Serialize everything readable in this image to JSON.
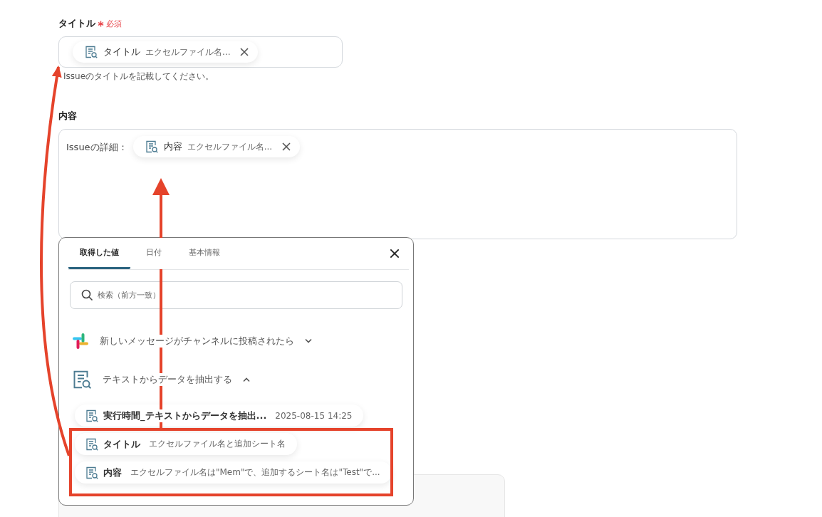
{
  "title_field": {
    "label": "タイトル",
    "required": "必須",
    "chip": {
      "name": "タイトル",
      "value": "エクセルファイル名..."
    },
    "help": "Issueのタイトルを記載してください。"
  },
  "content_field": {
    "label": "内容",
    "prefix": "Issueの詳細：",
    "chip": {
      "name": "内容",
      "value": "エクセルファイル名..."
    }
  },
  "popup": {
    "tabs": [
      {
        "label": "取得した値",
        "selected": true
      },
      {
        "label": "日付",
        "selected": false
      },
      {
        "label": "基本情報",
        "selected": false
      }
    ],
    "search": {
      "placeholder": "検索（前方一致）"
    },
    "sections": [
      {
        "kind": "slack",
        "title": "新しいメッセージがチャンネルに投稿されたら",
        "expanded": false
      },
      {
        "kind": "doc",
        "title": "テキストからデータを抽出する",
        "expanded": true
      }
    ],
    "items": [
      {
        "name": "実行時間_テキストからデータを抽出...",
        "value": "2025-08-15 14:25"
      },
      {
        "name": "タイトル",
        "value": "エクセルファイル名と追加シート名"
      },
      {
        "name": "内容",
        "value": "エクセルファイル名は\"Mem\"で、追加するシート名は\"Test\"で..."
      }
    ]
  }
}
